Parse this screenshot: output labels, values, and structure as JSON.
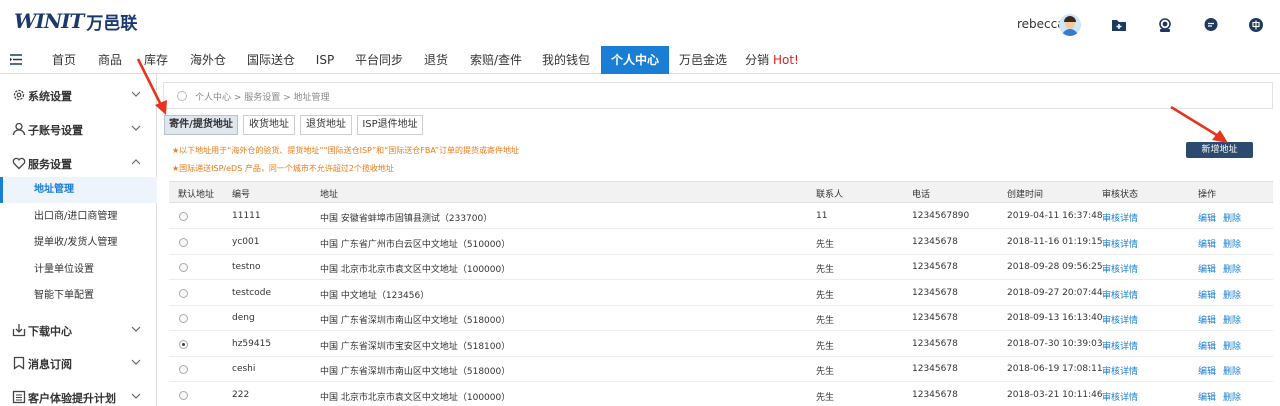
{
  "brand": {
    "logo_text": "WINIT",
    "name_cn": "万邑联"
  },
  "header": {
    "username": "rebecca"
  },
  "nav": {
    "items": [
      "首页",
      "商品",
      "库存",
      "海外仓",
      "国际送仓",
      "ISP",
      "平台同步",
      "退货",
      "索赔/查件",
      "我的钱包",
      "个人中心",
      "万邑金选",
      "分销"
    ],
    "hot_label": "Hot!",
    "active": "个人中心"
  },
  "sidebar": {
    "groups": [
      "系统设置",
      "子账号设置",
      "服务设置",
      "下载中心",
      "消息订阅",
      "客户体验提升计划"
    ],
    "service_sub": [
      "地址管理",
      "出口商/进口商管理",
      "提单收/发货人管理",
      "计量单位设置",
      "智能下单配置"
    ]
  },
  "breadcrumb": "个人中心 > 服务设置 > 地址管理",
  "tabs": [
    "寄件/提货地址",
    "收货地址",
    "退货地址",
    "ISP退件地址"
  ],
  "add_button": "新增地址",
  "notes": [
    "★以下地址用于“海外仓的验货、提货地址”“国际送仓ISP”和“国际送仓FBA”订单的提货或寄件地址",
    "★国际递送ISP/eDS 产品，同一个城市不允许超过2个揽收地址"
  ],
  "table": {
    "headers": [
      "默认地址",
      "编号",
      "地址",
      "联系人",
      "电话",
      "创建时间",
      "审核状态",
      "操作"
    ],
    "status_label": "审核详情",
    "edit_label": "编辑",
    "delete_label": "删除",
    "rows": [
      {
        "checked": false,
        "code": "11111",
        "address": "中国 安徽省蚌埠市固镇县测试（233700）",
        "contact": "11",
        "phone": "1234567890",
        "created": "2019-04-11 16:37:48"
      },
      {
        "checked": false,
        "code": "yc001",
        "address": "中国 广东省广州市白云区中文地址（510000）",
        "contact": "先生",
        "phone": "12345678",
        "created": "2018-11-16 01:19:15"
      },
      {
        "checked": false,
        "code": "testno",
        "address": "中国 北京市北京市袁文区中文地址（100000）",
        "contact": "先生",
        "phone": "12345678",
        "created": "2018-09-28 09:56:25"
      },
      {
        "checked": false,
        "code": "testcode",
        "address": "中国 中文地址（123456）",
        "contact": "先生",
        "phone": "12345678",
        "created": "2018-09-27 20:07:44"
      },
      {
        "checked": false,
        "code": "deng",
        "address": "中国 广东省深圳市南山区中文地址（518000）",
        "contact": "先生",
        "phone": "12345678",
        "created": "2018-09-13 16:13:40"
      },
      {
        "checked": true,
        "code": "hz59415",
        "address": "中国 广东省深圳市宝安区中文地址（518100）",
        "contact": "先生",
        "phone": "12345678",
        "created": "2018-07-30 10:39:03"
      },
      {
        "checked": false,
        "code": "ceshi",
        "address": "中国 广东省深圳市南山区中文地址（518000）",
        "contact": "先生",
        "phone": "12345678",
        "created": "2018-06-19 17:08:11"
      },
      {
        "checked": false,
        "code": "222",
        "address": "中国 北京市北京市袁文区中文地址（100000）",
        "contact": "先生",
        "phone": "12345678",
        "created": "2018-03-21 10:11:46"
      }
    ]
  },
  "icons": [
    "menu-icon",
    "folder-icon",
    "support-icon",
    "chat-icon",
    "language-icon",
    "gear-icon",
    "user-icon",
    "heart-icon",
    "download-icon",
    "bookmark-icon",
    "list-icon",
    "chevron-down-icon",
    "chevron-up-icon",
    "location-icon",
    "arrow-icon"
  ],
  "colors": {
    "primary": "#1a7ed4",
    "note": "#f07a14",
    "button": "#2c4a6e",
    "arrow": "#e8331f"
  }
}
